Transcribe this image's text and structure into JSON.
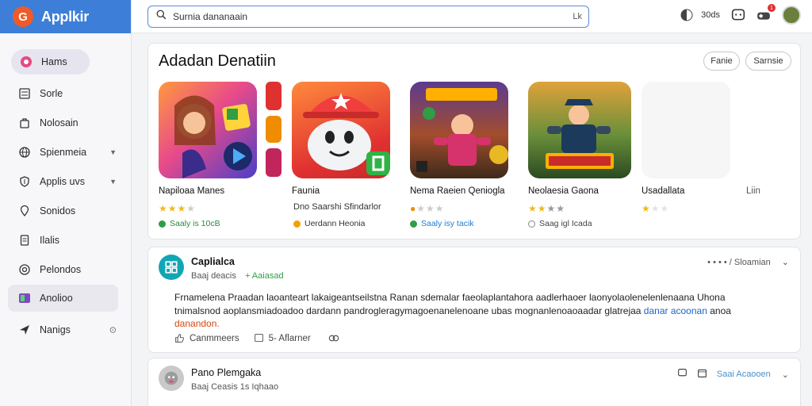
{
  "app": {
    "name": "Applkir",
    "logo_letter": "G"
  },
  "sidebar": {
    "items": [
      {
        "label": "Hams",
        "icon": "gamepad-icon"
      },
      {
        "label": "Sorle",
        "icon": "list-icon"
      },
      {
        "label": "Nolosain",
        "icon": "bag-icon"
      },
      {
        "label": "Spienmeia",
        "icon": "globe-icon",
        "expandable": true
      },
      {
        "label": "Applis uvs",
        "icon": "shield-icon",
        "expandable": true
      },
      {
        "label": "Sonidos",
        "icon": "pin-icon"
      },
      {
        "label": "Ilalis",
        "icon": "document-icon"
      },
      {
        "label": "Pelondos",
        "icon": "target-icon"
      },
      {
        "label": "Anolioo",
        "icon": "tv-icon"
      },
      {
        "label": "Nanigs",
        "icon": "compass-icon",
        "trailing": "⊙"
      }
    ]
  },
  "search": {
    "value": "Surnia dananaain",
    "shortcut": "Lk"
  },
  "topbar": {
    "counter_label": "30ds",
    "notif_count": "1"
  },
  "featured": {
    "title": "Adadan Denatiin",
    "buttons": {
      "filter": "Fanie",
      "sort": "Sarnsie"
    },
    "games": [
      {
        "name": "Napiloaa Manes",
        "stars": 3,
        "status": "Saaly is 10cB",
        "status_color": "#2f9e44",
        "text_color": "#2b8a3e"
      },
      {
        "name": "Faunia",
        "sub": "Dno Saarshi Sfindarlor",
        "status": "Uerdann Heonia",
        "status_color": "#f59f00",
        "text_color": "#333"
      },
      {
        "name": "Nema Raeien Qeniogla",
        "stars": 1,
        "status": "Saaly isy tacik",
        "status_color": "#2f9e44",
        "text_color": "#1c7ed6"
      },
      {
        "name": "Neolaesia Gaona",
        "stars": 3,
        "status": "Saag igl Icada",
        "status_color": "#888",
        "text_color": "#444"
      },
      {
        "name": "Usadallata",
        "stars": 1
      },
      {
        "name": "Liin"
      }
    ]
  },
  "posts": [
    {
      "author": "Caplialca",
      "meta": "Baaj deacis",
      "meta_tag": "+ Aaiasad",
      "right_text": "• • • • / Sloamian",
      "body_main": "Frnamelena Praadan laoanteart lakaigeantseilstna Ranan sdemalar faeolaplantahora aadlerhaoer laonyolaolenelenlenaana Uhona tnimalsnod aoplansmiadoadoo dardann pandrogleragymagoenanelenoane ubas mognanlenoaoaadar glatrejaa",
      "body_blue": "danar acoonan",
      "body_prefix": "anoa",
      "body_red": "danandon.",
      "actions": {
        "comments": "Canmmeers",
        "shares": "5- Aflarner"
      }
    },
    {
      "author": "Pano Plemgaka",
      "meta": "Baaj Ceasis 1s Iqhaao",
      "right_text": "Saai Acaooen"
    }
  ],
  "colors": {
    "brand": "#3d7fd8",
    "accent": "#f05a28"
  }
}
